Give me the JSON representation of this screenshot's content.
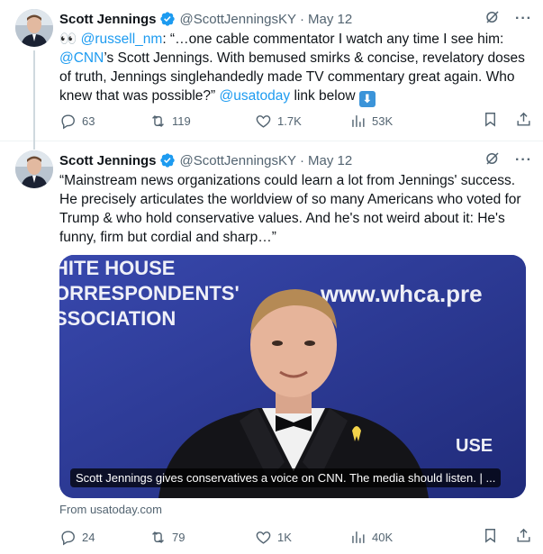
{
  "tweets": [
    {
      "author": "Scott Jennings",
      "handle": "@ScottJenningsKY",
      "date": "May 12",
      "text_parts": {
        "emoji": "👀",
        "mention1": "@russell_nm",
        "p1": ": “…one cable commentator I watch any time I see him: ",
        "mention2": "@CNN",
        "p2": "’s Scott Jennings. With bemused smirks & concise, revelatory doses of truth, Jennings singlehandedly made TV commentary great again. Who knew that was possible?” ",
        "mention3": "@usatoday",
        "p3": " link below ",
        "arrow": "⬇"
      },
      "actions": {
        "replies": "63",
        "retweets": "119",
        "likes": "1.7K",
        "views": "53K"
      }
    },
    {
      "author": "Scott Jennings",
      "handle": "@ScottJenningsKY",
      "date": "May 12",
      "text": "“Mainstream news organizations could learn a lot from Jennings' success. He precisely articulates the worldview of so many Americans who voted for Trump & who hold conservative values. And he's not weird about it: He's funny, firm but cordial and sharp…”",
      "card": {
        "caption": "Scott Jennings gives conservatives a voice on CNN. The media should listen. | ...",
        "source": "From usatoday.com",
        "backdrop_lines": [
          "HITE HOUSE",
          "ORRESPONDENTS'",
          "SSOCIATION"
        ],
        "backdrop_url": "www.whca.pre",
        "backdrop_bottom": "USE"
      },
      "actions": {
        "replies": "24",
        "retweets": "79",
        "likes": "1K",
        "views": "40K"
      }
    }
  ],
  "dot": "·",
  "more": "···",
  "colors": {
    "link": "#1d9bf0",
    "verified": "#1d9bf0",
    "muted": "#536471",
    "backdrop": "#2c3c98"
  }
}
